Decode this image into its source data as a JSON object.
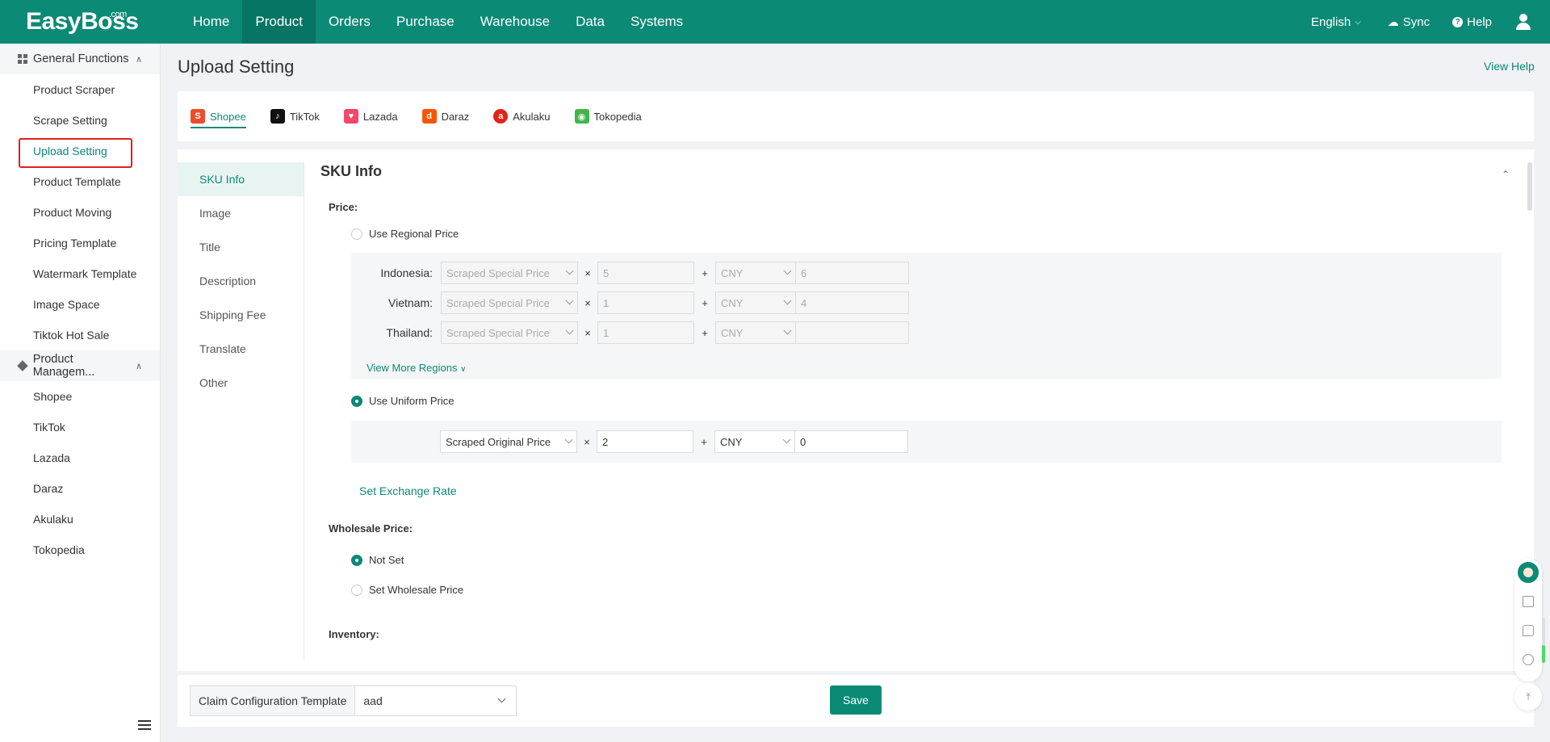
{
  "brand": {
    "logo": "EasyBoss",
    "logo_sup": ".com",
    "accent": "#0b8a76"
  },
  "topnav": {
    "items": [
      {
        "label": "Home"
      },
      {
        "label": "Product",
        "active": true
      },
      {
        "label": "Orders"
      },
      {
        "label": "Purchase"
      },
      {
        "label": "Warehouse"
      },
      {
        "label": "Data"
      },
      {
        "label": "Systems"
      }
    ],
    "language": "English",
    "sync": "Sync",
    "help": "Help"
  },
  "sidebar": {
    "group1": "General Functions",
    "group1_items": [
      "Product Scraper",
      "Scrape Setting",
      "Upload Setting",
      "Product Template",
      "Product Moving",
      "Pricing Template",
      "Watermark Template",
      "Image Space",
      "Tiktok Hot Sale"
    ],
    "group2": "Product Managem...",
    "group2_items": [
      "Shopee",
      "TikTok",
      "Lazada",
      "Daraz",
      "Akulaku",
      "Tokopedia"
    ]
  },
  "page": {
    "title": "Upload Setting",
    "view_help": "View Help"
  },
  "platforms": [
    {
      "label": "Shopee",
      "icon": "shopee-icon",
      "color": "#ee4d2d",
      "active": true
    },
    {
      "label": "TikTok",
      "icon": "tiktok-icon",
      "color": "#111111"
    },
    {
      "label": "Lazada",
      "icon": "lazada-icon",
      "color": "#f7466b"
    },
    {
      "label": "Daraz",
      "icon": "daraz-icon",
      "color": "#f85606"
    },
    {
      "label": "Akulaku",
      "icon": "akulaku-icon",
      "color": "#e2231a"
    },
    {
      "label": "Tokopedia",
      "icon": "tokopedia-icon",
      "color": "#42b549"
    }
  ],
  "inner_nav": [
    "SKU Info",
    "Image",
    "Title",
    "Description",
    "Shipping Fee",
    "Translate",
    "Other"
  ],
  "sku": {
    "title": "SKU Info",
    "price_label": "Price:",
    "regional_label": "Use Regional Price",
    "regions": [
      {
        "name": "Indonesia:",
        "base": "Scraped Special Price",
        "mult": "5",
        "currency": "CNY",
        "add": "6"
      },
      {
        "name": "Vietnam:",
        "base": "Scraped Special Price",
        "mult": "1",
        "currency": "CNY",
        "add": "4"
      },
      {
        "name": "Thailand:",
        "base": "Scraped Special Price",
        "mult": "1",
        "currency": "CNY",
        "add": ""
      }
    ],
    "view_more": "View More Regions",
    "uniform_label": "Use Uniform Price",
    "uniform": {
      "base": "Scraped Original Price",
      "mult": "2",
      "currency": "CNY",
      "add": "0"
    },
    "times": "×",
    "plus": "+",
    "exchange": "Set Exchange Rate",
    "wholesale_label": "Wholesale Price:",
    "not_set": "Not Set",
    "set_wholesale": "Set Wholesale Price",
    "inventory_label": "Inventory:"
  },
  "bottom": {
    "claim_label": "Claim Configuration Template",
    "claim_value": "aad",
    "save": "Save"
  },
  "float": {
    "progress": 0.4
  }
}
